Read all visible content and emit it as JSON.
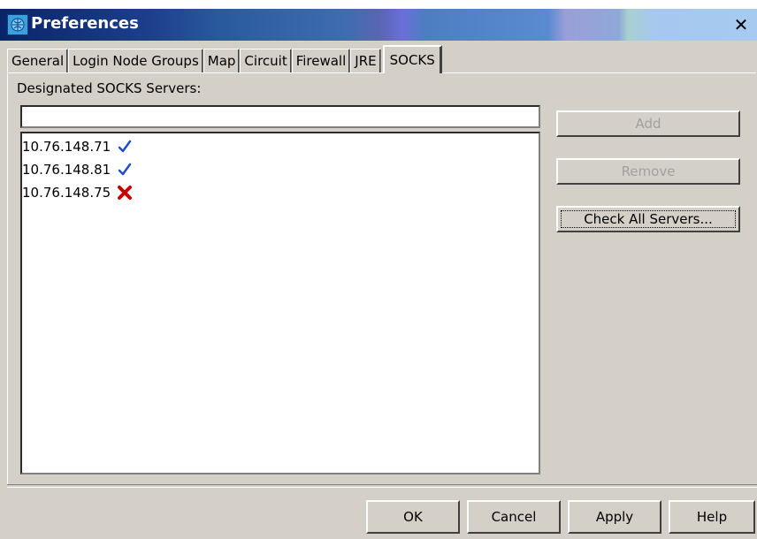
{
  "window": {
    "title": "Preferences",
    "close_glyph": "✕",
    "app_icon": "globe-network-icon"
  },
  "tabs": [
    {
      "label": "General",
      "active": false
    },
    {
      "label": "Login Node Groups",
      "active": false
    },
    {
      "label": "Map",
      "active": false
    },
    {
      "label": "Circuit",
      "active": false
    },
    {
      "label": "Firewall",
      "active": false
    },
    {
      "label": "JRE",
      "active": false
    },
    {
      "label": "SOCKS",
      "active": true
    }
  ],
  "socks": {
    "section_label": "Designated SOCKS Servers:",
    "input_value": "",
    "servers": [
      {
        "address": "10.76.148.71",
        "status": "ok",
        "icon": "checkmark-icon"
      },
      {
        "address": "10.76.148.81",
        "status": "ok",
        "icon": "checkmark-icon"
      },
      {
        "address": "10.76.148.75",
        "status": "failed",
        "icon": "red-x-icon"
      }
    ],
    "add_label": "Add",
    "remove_label": "Remove",
    "check_all_label": "Check All Servers..."
  },
  "footer": {
    "ok_label": "OK",
    "cancel_label": "Cancel",
    "apply_label": "Apply",
    "help_label": "Help"
  },
  "colors": {
    "dialog_bg": "#d4d0c8",
    "title_start": "#0a246a",
    "check_blue": "#1f4fd0",
    "x_red": "#cc0000"
  }
}
